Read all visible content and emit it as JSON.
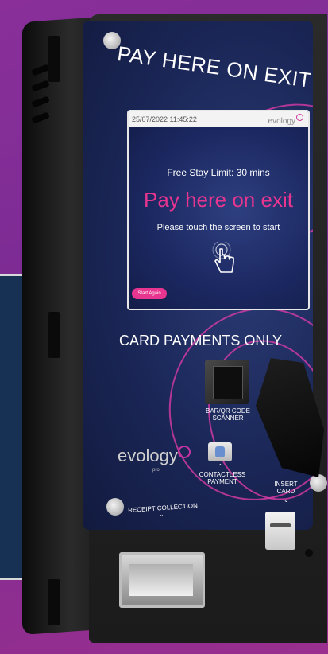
{
  "kiosk": {
    "headline": "PAY HERE ON EXIT",
    "screen": {
      "datetime": "25/07/2022 11:45:22",
      "logo_text": "evology",
      "free_stay": "Free Stay Limit: 30 mins",
      "main_title": "Pay here on exit",
      "touch_prompt": "Please touch the screen to start",
      "start_again_label": "Start Again"
    },
    "card_payments": "CARD PAYMENTS ONLY",
    "scanner_label": "BAR/QR CODE SCANNER",
    "contactless_label": "CONTACTLESS PAYMENT",
    "insert_card_label": "INSERT CARD",
    "receipt_label": "RECEIPT COLLECTION",
    "brand": "evology",
    "brand_sub": "pro",
    "colors": {
      "accent_pink": "#e8358f",
      "panel_navy": "#1a2656",
      "background_purple": "#8a2f9a"
    }
  }
}
